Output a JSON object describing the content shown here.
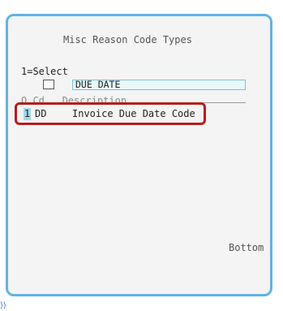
{
  "window": {
    "title": "Misc Reason Code Types",
    "select_legend": "1=Select",
    "filter": {
      "value": "DUE DATE"
    },
    "column_headers": "O Cd   Description",
    "rows": [
      {
        "option": "1",
        "code": "DD",
        "description": "Invoice Due Date Code"
      }
    ],
    "bottom_indicator": "Bottom"
  },
  "footer_glyph": "⟩⟩",
  "colors": {
    "window_border": "#5fb4e6",
    "highlight": "#b41e1e",
    "input_fill": "#e9f7fa"
  }
}
